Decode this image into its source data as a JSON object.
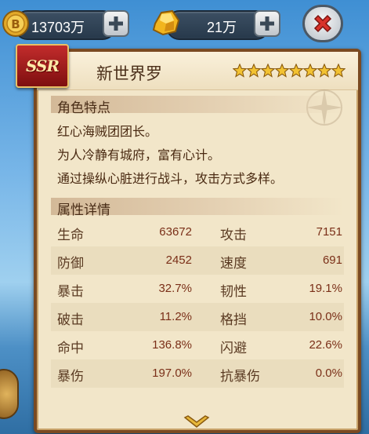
{
  "currency": {
    "coins": "13703万",
    "gold": "21万"
  },
  "icons": {
    "coin": "coin-icon",
    "gold": "gold-nugget-icon",
    "plus": "plus-icon",
    "close": "close-x-icon",
    "star": "star-icon",
    "down": "chevron-down-icon"
  },
  "hero": {
    "rarity": "SSR",
    "name": "新世界罗",
    "stars": 8
  },
  "traits": {
    "title": "角色特点",
    "lines": [
      "红心海贼团团长。",
      "为人冷静有城府，富有心计。",
      "通过操纵心脏进行战斗，攻击方式多样。"
    ]
  },
  "attributes": {
    "title": "属性详情",
    "rows": [
      {
        "left_label": "生命",
        "left_value": "63672",
        "right_label": "攻击",
        "right_value": "7151"
      },
      {
        "left_label": "防御",
        "left_value": "2452",
        "right_label": "速度",
        "right_value": "691"
      },
      {
        "left_label": "暴击",
        "left_value": "32.7%",
        "right_label": "韧性",
        "right_value": "19.1%"
      },
      {
        "left_label": "破击",
        "left_value": "11.2%",
        "right_label": "格挡",
        "right_value": "10.0%"
      },
      {
        "left_label": "命中",
        "left_value": "136.8%",
        "right_label": "闪避",
        "right_value": "22.6%"
      },
      {
        "left_label": "暴伤",
        "left_value": "197.0%",
        "right_label": "抗暴伤",
        "right_value": "0.0%"
      }
    ]
  },
  "colors": {
    "panel_bg": "#f2e6c9",
    "panel_border": "#7a4a22",
    "value_text": "#7a2f18",
    "star_gold": "#f2c232",
    "close_red": "#d8322a"
  }
}
